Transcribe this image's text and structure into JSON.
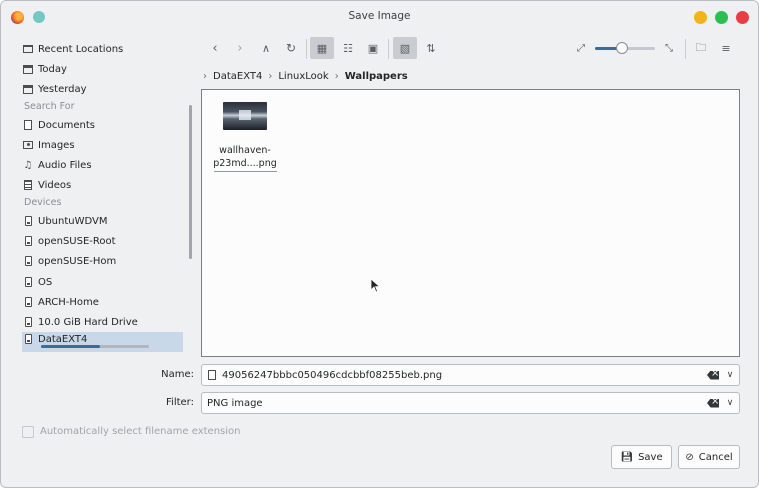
{
  "window": {
    "title": "Save Image"
  },
  "sidebar": {
    "places": [
      {
        "label": "Recent Locations",
        "icon": "recent-folder-icon"
      },
      {
        "label": "Today",
        "icon": "calendar-icon"
      },
      {
        "label": "Yesterday",
        "icon": "calendar-icon"
      }
    ],
    "search_header": "Search For",
    "search": [
      {
        "label": "Documents",
        "icon": "document-icon"
      },
      {
        "label": "Images",
        "icon": "image-icon"
      },
      {
        "label": "Audio Files",
        "icon": "music-icon"
      },
      {
        "label": "Videos",
        "icon": "video-icon"
      }
    ],
    "devices_header": "Devices",
    "devices": [
      {
        "label": "UbuntuWDVM",
        "icon": "drive-icon"
      },
      {
        "label": "openSUSE-Root",
        "icon": "drive-icon"
      },
      {
        "label": "openSUSE-Hom",
        "icon": "drive-icon"
      },
      {
        "label": "OS",
        "icon": "drive-icon"
      },
      {
        "label": "ARCH-Home",
        "icon": "drive-icon"
      },
      {
        "label": "10.0 GiB Hard Drive",
        "icon": "drive-icon"
      },
      {
        "label": "DataEXT4",
        "icon": "drive-icon",
        "selected": true,
        "usage": 0.55
      }
    ]
  },
  "breadcrumb": {
    "parts": [
      "DataEXT4",
      "LinuxLook"
    ],
    "current": "Wallpapers"
  },
  "files": [
    {
      "name_line1": "wallhaven-",
      "name_line2": "p23md....png"
    }
  ],
  "zoom": {
    "level": 0.45
  },
  "form": {
    "name_label": "Name:",
    "name_value": "49056247bbbc050496cdcbbf08255beb.png",
    "filter_label": "Filter:",
    "filter_value": "PNG image",
    "auto_ext_label": "Automatically select filename extension"
  },
  "buttons": {
    "save": "Save",
    "cancel": "Cancel"
  },
  "colors": {
    "accent": "#3a6b99",
    "selection": "#c8d8e8"
  }
}
